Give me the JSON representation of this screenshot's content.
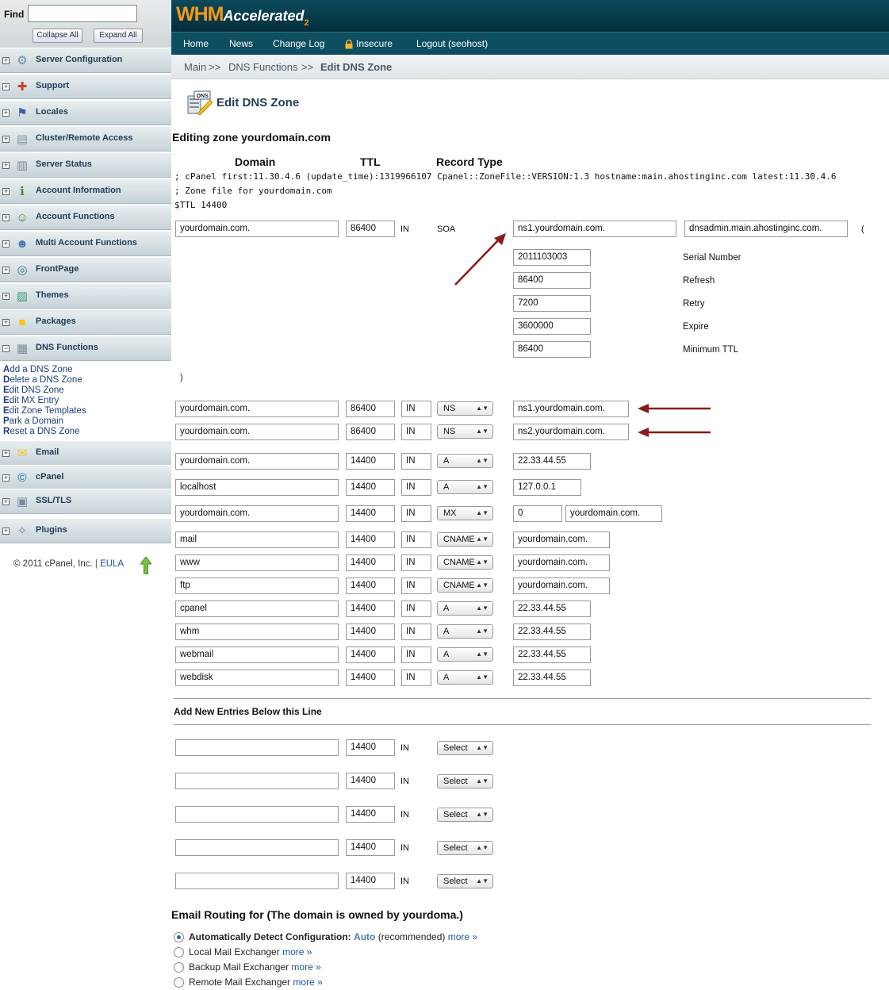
{
  "sidebar": {
    "find_label": "Find",
    "find_value": "",
    "collapse_all": "Collapse All",
    "expand_all": "Expand All",
    "sections": [
      {
        "label": "Server Configuration",
        "icon": "server-config-icon"
      },
      {
        "label": "Support",
        "icon": "lifebuoy-icon"
      },
      {
        "label": "Locales",
        "icon": "flag-icon"
      },
      {
        "label": "Cluster/Remote Access",
        "icon": "cluster-icon"
      },
      {
        "label": "Server Status",
        "icon": "server-status-icon"
      },
      {
        "label": "Account Information",
        "icon": "account-info-icon"
      },
      {
        "label": "Account Functions",
        "icon": "account-functions-icon"
      },
      {
        "label": "Multi Account Functions",
        "icon": "multi-account-icon"
      },
      {
        "label": "FrontPage",
        "icon": "frontpage-icon"
      },
      {
        "label": "Themes",
        "icon": "themes-icon"
      },
      {
        "label": "Packages",
        "icon": "packages-icon"
      },
      {
        "label": "DNS Functions",
        "icon": "dns-icon"
      },
      {
        "label": "Email",
        "icon": "envelope-icon"
      },
      {
        "label": "cPanel",
        "icon": "cpanel-icon"
      },
      {
        "label": "SSL/TLS",
        "icon": "certificate-icon"
      },
      {
        "label": "Plugins",
        "icon": "puzzle-icon"
      }
    ],
    "dns_links": [
      {
        "key": "A",
        "rest": "dd a DNS Zone"
      },
      {
        "key": "D",
        "rest": "elete a DNS Zone"
      },
      {
        "key": "E",
        "rest": "dit DNS Zone"
      },
      {
        "key": "E",
        "rest": "dit MX Entry"
      },
      {
        "key": "E",
        "rest": "dit Zone Templates"
      },
      {
        "key": "P",
        "rest": "ark a Domain"
      },
      {
        "key": "R",
        "rest": "eset a DNS Zone"
      }
    ],
    "copyright": "© 2011 cPanel, Inc.",
    "eula": "EULA"
  },
  "header": {
    "logo_main": "WHM",
    "logo_sub": "Accelerated",
    "logo_num": "2",
    "nav": [
      "Home",
      "News",
      "Change Log",
      "Insecure",
      "Logout (seohost)"
    ]
  },
  "breadcrumb": {
    "main": "Main",
    "sep": ">>",
    "parent": "DNS Functions",
    "current": "Edit DNS Zone"
  },
  "page": {
    "title": "Edit DNS Zone",
    "zone_heading": "Editing zone yourdomain.com",
    "col_domain": "Domain",
    "col_ttl": "TTL",
    "col_type": "Record Type",
    "raw_line1": "; cPanel first:11.30.4.6 (update_time):1319966107 Cpanel::ZoneFile::VERSION:1.3 hostname:main.ahostinginc.com latest:11.30.4.6",
    "raw_line2": "; Zone file for yourdomain.com",
    "raw_line3": "$TTL 14400"
  },
  "soa": {
    "domain": "yourdomain.com.",
    "ttl": "86400",
    "class": "IN",
    "type": "SOA",
    "primary_ns": "ns1.yourdomain.com.",
    "admin": "dnsadmin.main.ahostinginc.com.",
    "open_paren": "(",
    "close_paren": ")",
    "fields": [
      {
        "value": "2011103003",
        "label": "Serial Number"
      },
      {
        "value": "86400",
        "label": "Refresh"
      },
      {
        "value": "7200",
        "label": "Retry"
      },
      {
        "value": "3600000",
        "label": "Expire"
      },
      {
        "value": "86400",
        "label": "Minimum TTL"
      }
    ]
  },
  "records": [
    {
      "domain": "yourdomain.com.",
      "ttl": "86400",
      "class": "IN",
      "type": "NS",
      "value": "ns1.yourdomain.com.",
      "extra": ""
    },
    {
      "domain": "yourdomain.com.",
      "ttl": "86400",
      "class": "IN",
      "type": "NS",
      "value": "ns2.yourdomain.com.",
      "extra": ""
    },
    {
      "domain": "yourdomain.com.",
      "ttl": "14400",
      "class": "IN",
      "type": "A",
      "value": "22.33.44.55",
      "extra": ""
    },
    {
      "domain": "localhost",
      "ttl": "14400",
      "class": "IN",
      "type": "A",
      "value": "127.0.0.1",
      "extra": ""
    },
    {
      "domain": "yourdomain.com.",
      "ttl": "14400",
      "class": "IN",
      "type": "MX",
      "value": "0",
      "extra": "yourdomain.com."
    },
    {
      "domain": "mail",
      "ttl": "14400",
      "class": "IN",
      "type": "CNAME",
      "value": "yourdomain.com.",
      "extra": ""
    },
    {
      "domain": "www",
      "ttl": "14400",
      "class": "IN",
      "type": "CNAME",
      "value": "yourdomain.com.",
      "extra": ""
    },
    {
      "domain": "ftp",
      "ttl": "14400",
      "class": "IN",
      "type": "CNAME",
      "value": "yourdomain.com.",
      "extra": ""
    },
    {
      "domain": "cpanel",
      "ttl": "14400",
      "class": "IN",
      "type": "A",
      "value": "22.33.44.55",
      "extra": ""
    },
    {
      "domain": "whm",
      "ttl": "14400",
      "class": "IN",
      "type": "A",
      "value": "22.33.44.55",
      "extra": ""
    },
    {
      "domain": "webmail",
      "ttl": "14400",
      "class": "IN",
      "type": "A",
      "value": "22.33.44.55",
      "extra": ""
    },
    {
      "domain": "webdisk",
      "ttl": "14400",
      "class": "IN",
      "type": "A",
      "value": "22.33.44.55",
      "extra": ""
    }
  ],
  "new_entries": {
    "heading": "Add New Entries Below this Line",
    "rows": [
      {
        "domain": "",
        "ttl": "14400",
        "class": "IN",
        "type": "Select"
      },
      {
        "domain": "",
        "ttl": "14400",
        "class": "IN",
        "type": "Select"
      },
      {
        "domain": "",
        "ttl": "14400",
        "class": "IN",
        "type": "Select"
      },
      {
        "domain": "",
        "ttl": "14400",
        "class": "IN",
        "type": "Select"
      },
      {
        "domain": "",
        "ttl": "14400",
        "class": "IN",
        "type": "Select"
      }
    ]
  },
  "email_routing": {
    "heading": "Email Routing for (The domain is owned by yourdoma.)",
    "options": [
      {
        "label": "Automatically Detect Configuration:",
        "value": "Auto",
        "note": "(recommended)",
        "more": "more »",
        "selected": true
      },
      {
        "label": "Local Mail Exchanger",
        "value": "",
        "note": "",
        "more": "more »",
        "selected": false
      },
      {
        "label": "Backup Mail Exchanger",
        "value": "",
        "note": "",
        "more": "more »",
        "selected": false
      },
      {
        "label": "Remote Mail Exchanger",
        "value": "",
        "note": "",
        "more": "more »",
        "selected": false
      }
    ]
  },
  "colors": {
    "header_bg": "#052e3a",
    "nav_bg": "#0d4f61",
    "logo_orange": "#f39a1b",
    "arrow_red": "#8b1a1a",
    "link_blue": "#1f3c7a"
  }
}
